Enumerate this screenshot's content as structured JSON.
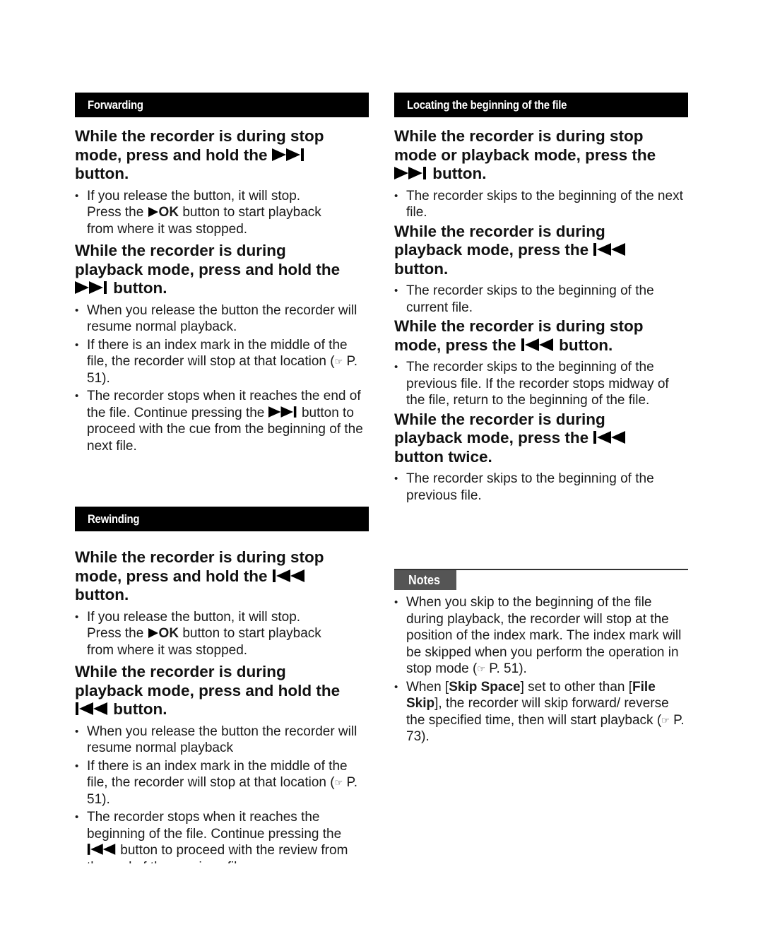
{
  "left_column": {
    "forwarding": {
      "section_title": "Forwarding",
      "blocks": [
        {
          "heading": [
            "While the recorder is during stop",
            "mode, press and hold the",
            "button."
          ],
          "heading_icon": "fast-forward-skip-icon",
          "bullets": [
            {
              "parts": [
                "If you release the button, it will stop.",
                "Press the",
                "OK",
                "button to start playback",
                "from where it was stopped."
              ]
            }
          ]
        },
        {
          "heading": [
            "While the recorder is during",
            "playback mode, press and hold the",
            "button."
          ],
          "heading_icon": "fast-forward-skip-icon",
          "bullets": [
            {
              "text": "When you release the button the recorder will resume normal playback."
            },
            {
              "text": "If there is an index mark in the middle of the file, the recorder will stop at that location (",
              "ref": "P. 51",
              "tail": ")."
            },
            {
              "pre": "The recorder stops when it reaches the end of the file. Continue pressing the",
              "post": "button to proceed with the cue from the beginning of the next file."
            }
          ]
        }
      ]
    },
    "rewinding": {
      "section_title": "Rewinding",
      "blocks": [
        {
          "heading": [
            "While the recorder is during stop",
            "mode, press and hold the",
            "button."
          ],
          "heading_icon": "rewind-skip-icon",
          "bullets": [
            {
              "parts": [
                "If you release the button, it will stop.",
                "Press the",
                "OK",
                "button to start playback",
                "from where it was stopped."
              ]
            }
          ]
        },
        {
          "heading": [
            "While the recorder is during",
            "playback mode, press and hold the",
            "button."
          ],
          "heading_icon": "rewind-skip-icon",
          "bullets": [
            {
              "text": "When you release the button the recorder will resume normal playback"
            },
            {
              "text": "If there is an index mark in the middle of the file, the recorder will stop at that location (",
              "ref": "P. 51",
              "tail": ")."
            },
            {
              "pre": "The recorder stops when it reaches the beginning of the file. Continue pressing the",
              "post": "button to proceed with the review from the end of the previous file."
            }
          ]
        }
      ]
    }
  },
  "right_column": {
    "locating": {
      "section_title": "Locating the beginning of the file",
      "blocks": [
        {
          "heading": [
            "While the recorder is during stop",
            "mode or playback mode, press the",
            "button."
          ],
          "heading_icon": "fast-forward-skip-icon",
          "bullets": [
            {
              "text": "The recorder skips to the beginning of the next file."
            }
          ]
        },
        {
          "heading": [
            "While the recorder is during",
            "playback mode, press the",
            "button."
          ],
          "heading_icon": "rewind-skip-icon",
          "bullets": [
            {
              "text": "The recorder skips to the beginning of the current file."
            }
          ]
        },
        {
          "heading": [
            "While the recorder is during stop",
            "mode, press the",
            "button."
          ],
          "heading_icon": "rewind-skip-icon",
          "bullets": [
            {
              "text": "The recorder skips to the beginning of the previous file. If the recorder stops midway of the file, return to the beginning of the file."
            }
          ]
        },
        {
          "heading": [
            "While the recorder is during",
            "playback mode, press the",
            "button twice."
          ],
          "heading_icon": "rewind-skip-icon",
          "bullets": [
            {
              "text": "The recorder skips to the beginning of the previous file."
            }
          ]
        }
      ]
    },
    "notes": {
      "label": "Notes",
      "items": [
        {
          "text": "When you skip to the beginning of the file during playback, the recorder will stop at the position of the index mark. The index mark will be skipped when you perform the operation in stop mode (",
          "ref": "P. 51",
          "tail": ")."
        },
        {
          "a": "When [",
          "b1": "Skip Space",
          "c": "] set to other than [",
          "b2": "File Skip",
          "d": "], the recorder will skip forward/ reverse the specified time, then will start playback (",
          "ref": "P. 73",
          "tail": ")."
        }
      ]
    }
  },
  "icons": {
    "pointing_hand": "☞"
  }
}
